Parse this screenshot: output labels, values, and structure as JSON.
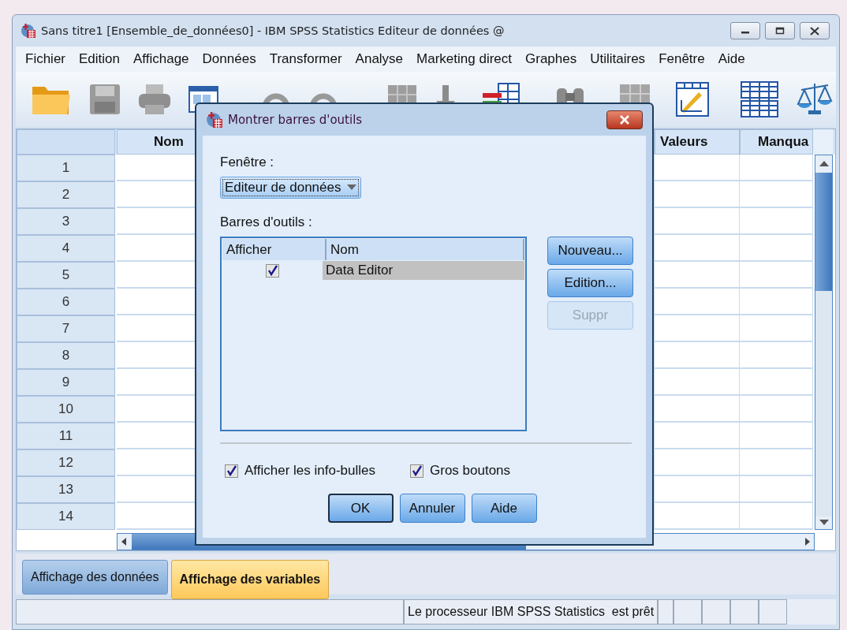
{
  "window": {
    "title": "Sans titre1 [Ensemble_de_données0] - IBM SPSS Statistics Editeur de données @"
  },
  "menu": [
    "Fichier",
    "Edition",
    "Affichage",
    "Données",
    "Transformer",
    "Analyse",
    "Marketing direct",
    "Graphes",
    "Utilitaires",
    "Fenêtre",
    "Aide"
  ],
  "grid": {
    "columns": [
      "Nom",
      "Valeurs",
      "Manqua"
    ],
    "row_numbers": [
      "1",
      "2",
      "3",
      "4",
      "5",
      "6",
      "7",
      "8",
      "9",
      "10",
      "11",
      "12",
      "13",
      "14"
    ]
  },
  "view_tabs": [
    {
      "label": "Affichage des données",
      "selected": false
    },
    {
      "label": "Affichage des variables",
      "selected": true
    }
  ],
  "status_bar": {
    "message": "Le processeur IBM SPSS Statistics  est prêt"
  },
  "dialog": {
    "title": "Montrer barres d'outils",
    "window_label": "Fenêtre :",
    "window_value": "Editeur de données",
    "toolbars_label": "Barres d'outils :",
    "list_columns": [
      "Afficher",
      "Nom"
    ],
    "list_rows": [
      {
        "checked": true,
        "name": "Data Editor",
        "selected": true
      }
    ],
    "side_buttons": [
      {
        "label": "Nouveau...",
        "disabled": false
      },
      {
        "label": "Edition...",
        "disabled": false
      },
      {
        "label": "Suppr",
        "disabled": true
      }
    ],
    "options": [
      {
        "label": "Afficher les info-bulles",
        "checked": true
      },
      {
        "label": "Gros boutons",
        "checked": true
      }
    ],
    "buttons": [
      {
        "label": "OK",
        "default": true
      },
      {
        "label": "Annuler",
        "default": false
      },
      {
        "label": "Aide",
        "default": false
      }
    ]
  }
}
